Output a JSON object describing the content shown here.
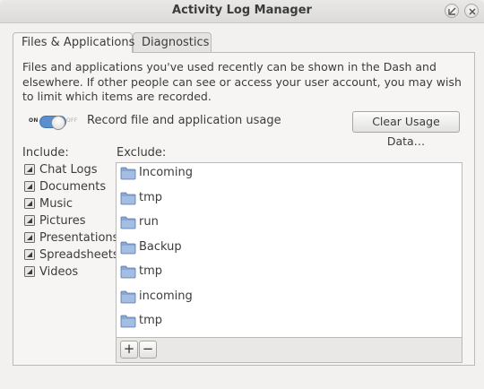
{
  "window": {
    "title": "Activity Log Manager"
  },
  "tabs": [
    {
      "label": "Files & Applications",
      "active": true
    },
    {
      "label": "Diagnostics",
      "active": false
    }
  ],
  "description": "Files and applications you've used recently can be shown in the Dash and elsewhere. If other people can see or access your user account, you may wish to limit which items are recorded.",
  "record": {
    "switch_on_label": "ON",
    "switch_off_label": "OFF",
    "enabled": true,
    "label": "Record file and application usage"
  },
  "clear_button": "Clear Usage Data…",
  "include": {
    "header": "Include:",
    "items": [
      "Chat Logs",
      "Documents",
      "Music",
      "Pictures",
      "Presentations",
      "Spreadsheets",
      "Videos"
    ]
  },
  "exclude": {
    "header": "Exclude:",
    "items": [
      "Incoming",
      "tmp",
      "run",
      "Backup",
      "tmp",
      "incoming",
      "tmp"
    ]
  },
  "toolbar": {
    "add_label": "+",
    "remove_label": "−"
  },
  "colors": {
    "accent": "#5a8fd0",
    "folder": "#8aa8d6"
  }
}
